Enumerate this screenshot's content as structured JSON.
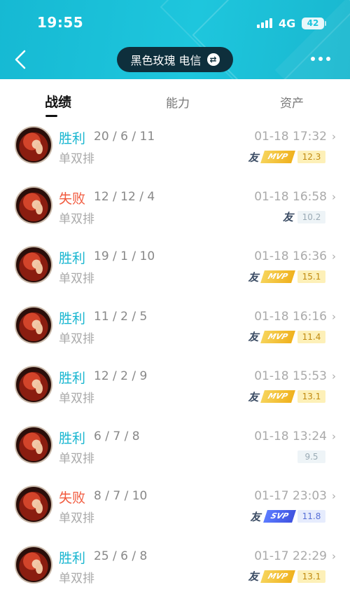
{
  "status_bar": {
    "time": "19:55",
    "network": "4G",
    "battery": "42"
  },
  "nav": {
    "account_name": "黑色玫瑰 电信",
    "swap_icon": "⇄"
  },
  "tabs": [
    {
      "label": "战绩"
    },
    {
      "label": "能力"
    },
    {
      "label": "资产"
    }
  ],
  "matches": [
    {
      "result": "胜利",
      "outcome": "win",
      "kda": "20 / 6 / 11",
      "mode": "单双排",
      "time": "01-18 17:32",
      "friend": "友",
      "medal": "MVP",
      "medal_type": "mvp",
      "score": "12.3",
      "score_style": "gold"
    },
    {
      "result": "失败",
      "outcome": "lose",
      "kda": "12 / 12 / 4",
      "mode": "单双排",
      "time": "01-18 16:58",
      "friend": "友",
      "medal": "",
      "medal_type": "",
      "score": "10.2",
      "score_style": "plain"
    },
    {
      "result": "胜利",
      "outcome": "win",
      "kda": "19 / 1 / 10",
      "mode": "单双排",
      "time": "01-18 16:36",
      "friend": "友",
      "medal": "MVP",
      "medal_type": "mvp",
      "score": "15.1",
      "score_style": "gold"
    },
    {
      "result": "胜利",
      "outcome": "win",
      "kda": "11 / 2 / 5",
      "mode": "单双排",
      "time": "01-18 16:16",
      "friend": "友",
      "medal": "MVP",
      "medal_type": "mvp",
      "score": "11.4",
      "score_style": "gold"
    },
    {
      "result": "胜利",
      "outcome": "win",
      "kda": "12 / 2 / 9",
      "mode": "单双排",
      "time": "01-18 15:53",
      "friend": "友",
      "medal": "MVP",
      "medal_type": "mvp",
      "score": "13.1",
      "score_style": "gold"
    },
    {
      "result": "胜利",
      "outcome": "win",
      "kda": "6 / 7 / 8",
      "mode": "单双排",
      "time": "01-18 13:24",
      "friend": "",
      "medal": "",
      "medal_type": "",
      "score": "9.5",
      "score_style": "plain"
    },
    {
      "result": "失败",
      "outcome": "lose",
      "kda": "8 / 7 / 10",
      "mode": "单双排",
      "time": "01-17 23:03",
      "friend": "友",
      "medal": "SVP",
      "medal_type": "svp",
      "score": "11.8",
      "score_style": "blue"
    },
    {
      "result": "胜利",
      "outcome": "win",
      "kda": "25 / 6 / 8",
      "mode": "单双排",
      "time": "01-17 22:29",
      "friend": "友",
      "medal": "MVP",
      "medal_type": "mvp",
      "score": "13.1",
      "score_style": "gold"
    }
  ],
  "colors": {
    "header": "#1ec6dd",
    "win": "#18b6d0",
    "lose": "#f15a3e",
    "pill": "#0e2f3c"
  }
}
